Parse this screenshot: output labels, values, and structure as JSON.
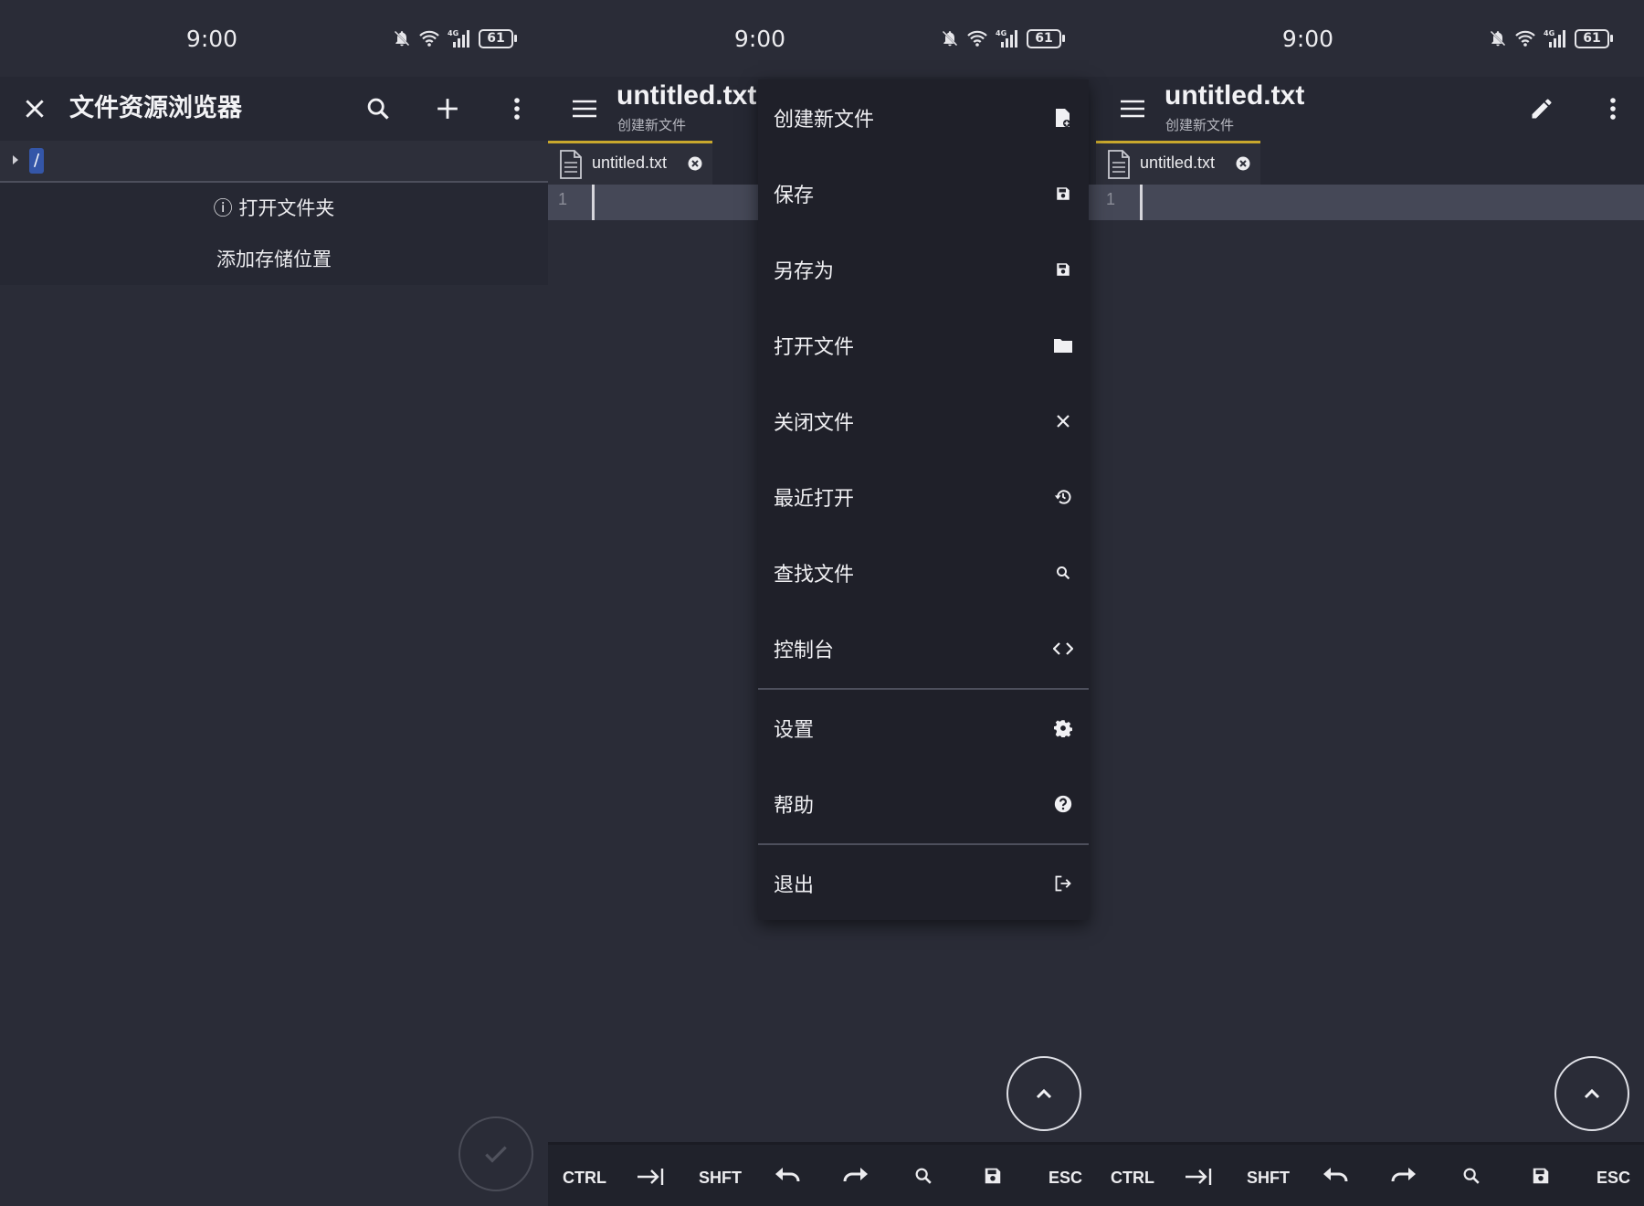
{
  "status": {
    "time": "9:00",
    "battery": "61",
    "network": "4G"
  },
  "explorer": {
    "title": "文件资源浏览器",
    "root": "/",
    "open_folder": "ⓘ 打开文件夹",
    "add_storage": "添加存储位置"
  },
  "editor": {
    "file_name": "untitled.txt",
    "subtitle": "创建新文件",
    "tab_label": "untitled.txt",
    "line_number": "1"
  },
  "toolbar": {
    "ctrl": "CTRL",
    "shift": "SHFT",
    "esc": "ESC"
  },
  "menu": {
    "items": [
      {
        "label": "创建新文件",
        "icon": "new-file-icon"
      },
      {
        "label": "保存",
        "icon": "save-icon"
      },
      {
        "label": "另存为",
        "icon": "save-as-icon"
      },
      {
        "label": "打开文件",
        "icon": "folder-icon"
      },
      {
        "label": "关闭文件",
        "icon": "close-icon"
      },
      {
        "label": "最近打开",
        "icon": "history-icon"
      },
      {
        "label": "查找文件",
        "icon": "search-icon"
      },
      {
        "label": "控制台",
        "icon": "code-icon"
      },
      {
        "label": "设置",
        "icon": "gear-icon"
      },
      {
        "label": "帮助",
        "icon": "help-icon"
      },
      {
        "label": "退出",
        "icon": "exit-icon"
      }
    ]
  },
  "colors": {
    "background": "#2a2c37",
    "appbar": "#262833",
    "tab_accent": "#c9a82d",
    "menu": "#1f2029"
  }
}
